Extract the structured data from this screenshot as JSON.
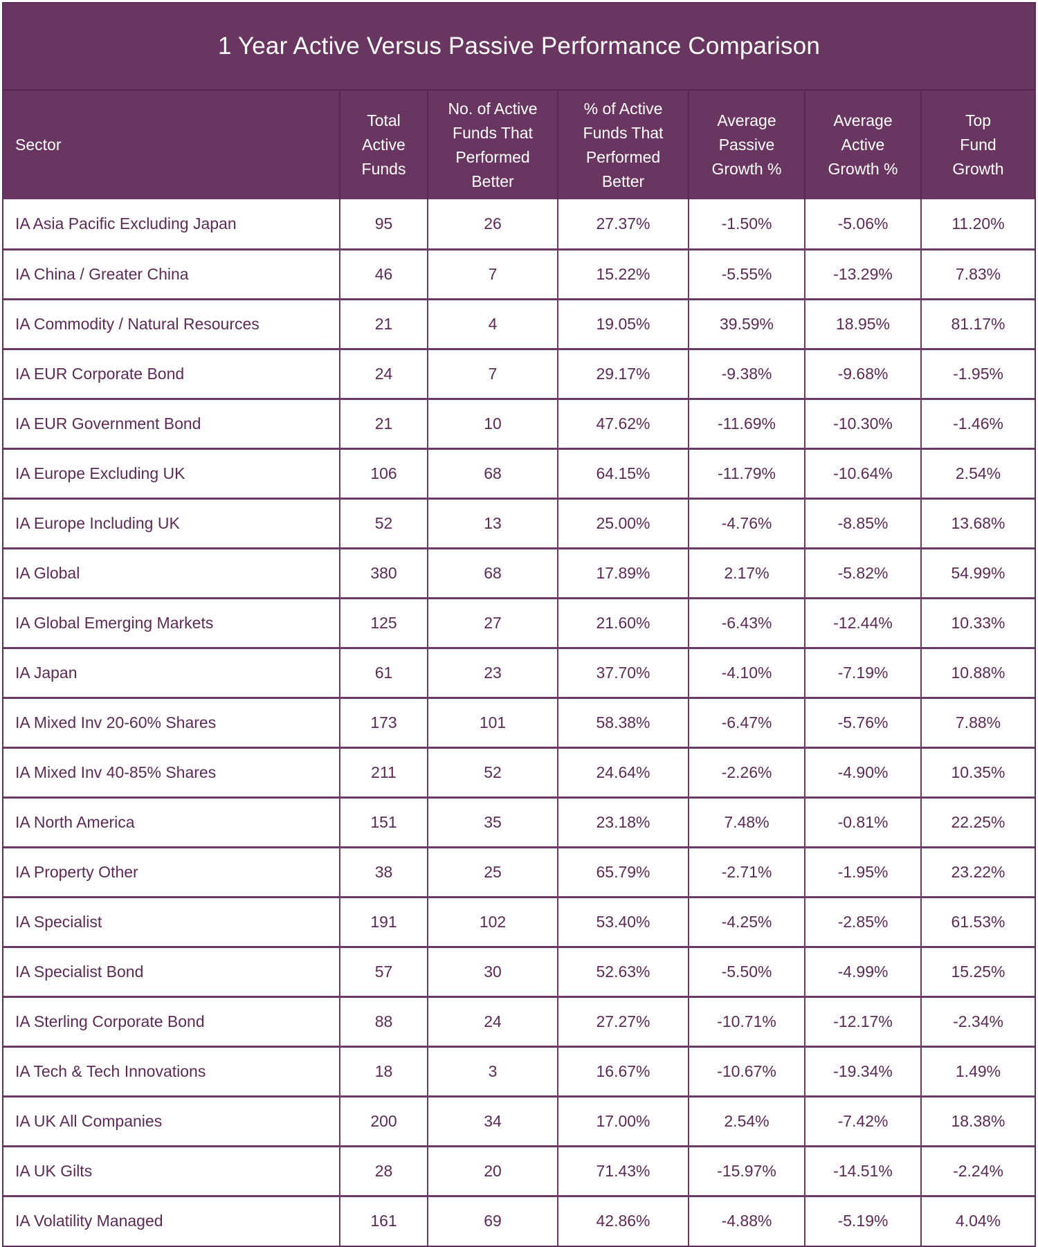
{
  "title": "1 Year Active Versus Passive Performance Comparison",
  "colors": {
    "header_bg": "#693661",
    "header_text": "#ffffff",
    "body_text": "#5c2a57",
    "border": "#6a3965"
  },
  "columns": [
    "Sector",
    "Total Active Funds",
    "No. of Active Funds That Performed Better",
    "% of Active Funds That Performed Better",
    "Average Passive Growth %",
    "Average Active Growth %",
    "Top Fund Growth"
  ],
  "rows": [
    [
      "IA Asia Pacific Excluding Japan",
      "95",
      "26",
      "27.37%",
      "-1.50%",
      "-5.06%",
      "11.20%"
    ],
    [
      "IA China / Greater China",
      "46",
      "7",
      "15.22%",
      "-5.55%",
      "-13.29%",
      "7.83%"
    ],
    [
      "IA Commodity / Natural Resources",
      "21",
      "4",
      "19.05%",
      "39.59%",
      "18.95%",
      "81.17%"
    ],
    [
      "IA EUR Corporate Bond",
      "24",
      "7",
      "29.17%",
      "-9.38%",
      "-9.68%",
      "-1.95%"
    ],
    [
      "IA EUR Government Bond",
      "21",
      "10",
      "47.62%",
      "-11.69%",
      "-10.30%",
      "-1.46%"
    ],
    [
      "IA Europe Excluding UK",
      "106",
      "68",
      "64.15%",
      "-11.79%",
      "-10.64%",
      "2.54%"
    ],
    [
      "IA Europe Including UK",
      "52",
      "13",
      "25.00%",
      "-4.76%",
      "-8.85%",
      "13.68%"
    ],
    [
      "IA Global",
      "380",
      "68",
      "17.89%",
      "2.17%",
      "-5.82%",
      "54.99%"
    ],
    [
      "IA Global Emerging Markets",
      "125",
      "27",
      "21.60%",
      "-6.43%",
      "-12.44%",
      "10.33%"
    ],
    [
      "IA Japan",
      "61",
      "23",
      "37.70%",
      "-4.10%",
      "-7.19%",
      "10.88%"
    ],
    [
      "IA Mixed Inv 20-60% Shares",
      "173",
      "101",
      "58.38%",
      "-6.47%",
      "-5.76%",
      "7.88%"
    ],
    [
      "IA Mixed Inv 40-85% Shares",
      "211",
      "52",
      "24.64%",
      "-2.26%",
      "-4.90%",
      "10.35%"
    ],
    [
      "IA North America",
      "151",
      "35",
      "23.18%",
      "7.48%",
      "-0.81%",
      "22.25%"
    ],
    [
      "IA Property Other",
      "38",
      "25",
      "65.79%",
      "-2.71%",
      "-1.95%",
      "23.22%"
    ],
    [
      "IA Specialist",
      "191",
      "102",
      "53.40%",
      "-4.25%",
      "-2.85%",
      "61.53%"
    ],
    [
      "IA Specialist Bond",
      "57",
      "30",
      "52.63%",
      "-5.50%",
      "-4.99%",
      "15.25%"
    ],
    [
      "IA Sterling Corporate Bond",
      "88",
      "24",
      "27.27%",
      "-10.71%",
      "-12.17%",
      "-2.34%"
    ],
    [
      "IA Tech & Tech Innovations",
      "18",
      "3",
      "16.67%",
      "-10.67%",
      "-19.34%",
      "1.49%"
    ],
    [
      "IA UK All Companies",
      "200",
      "34",
      "17.00%",
      "2.54%",
      "-7.42%",
      "18.38%"
    ],
    [
      "IA UK Gilts",
      "28",
      "20",
      "71.43%",
      "-15.97%",
      "-14.51%",
      "-2.24%"
    ],
    [
      "IA Volatility Managed",
      "161",
      "69",
      "42.86%",
      "-4.88%",
      "-5.19%",
      "4.04%"
    ]
  ]
}
